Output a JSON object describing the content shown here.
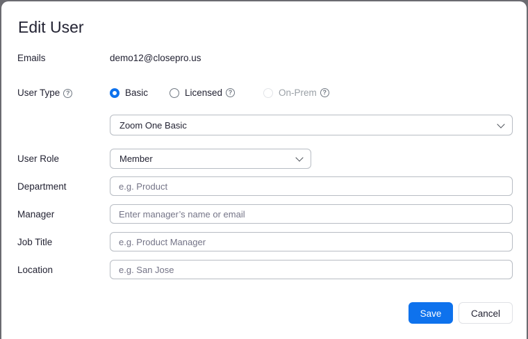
{
  "dialog": {
    "title": "Edit User",
    "save_label": "Save",
    "cancel_label": "Cancel"
  },
  "emails": {
    "label": "Emails",
    "value": "demo12@closepro.us"
  },
  "user_type": {
    "label": "User Type",
    "options": [
      {
        "label": "Basic",
        "checked": true,
        "disabled": false
      },
      {
        "label": "Licensed",
        "checked": false,
        "disabled": false
      },
      {
        "label": "On-Prem",
        "checked": false,
        "disabled": true
      }
    ],
    "plan_select": "Zoom One Basic"
  },
  "user_role": {
    "label": "User Role",
    "value": "Member"
  },
  "department": {
    "label": "Department",
    "placeholder": "e.g. Product"
  },
  "manager": {
    "label": "Manager",
    "placeholder": "Enter manager’s name or email"
  },
  "job_title": {
    "label": "Job Title",
    "placeholder": "e.g. Product Manager"
  },
  "location": {
    "label": "Location",
    "placeholder": "e.g. San Jose"
  },
  "icons": {
    "help": "question-circle-icon",
    "chevron": "chevron-down-icon"
  },
  "colors": {
    "accent": "#0e72ed",
    "text": "#232333",
    "border": "#b7bcc3"
  }
}
